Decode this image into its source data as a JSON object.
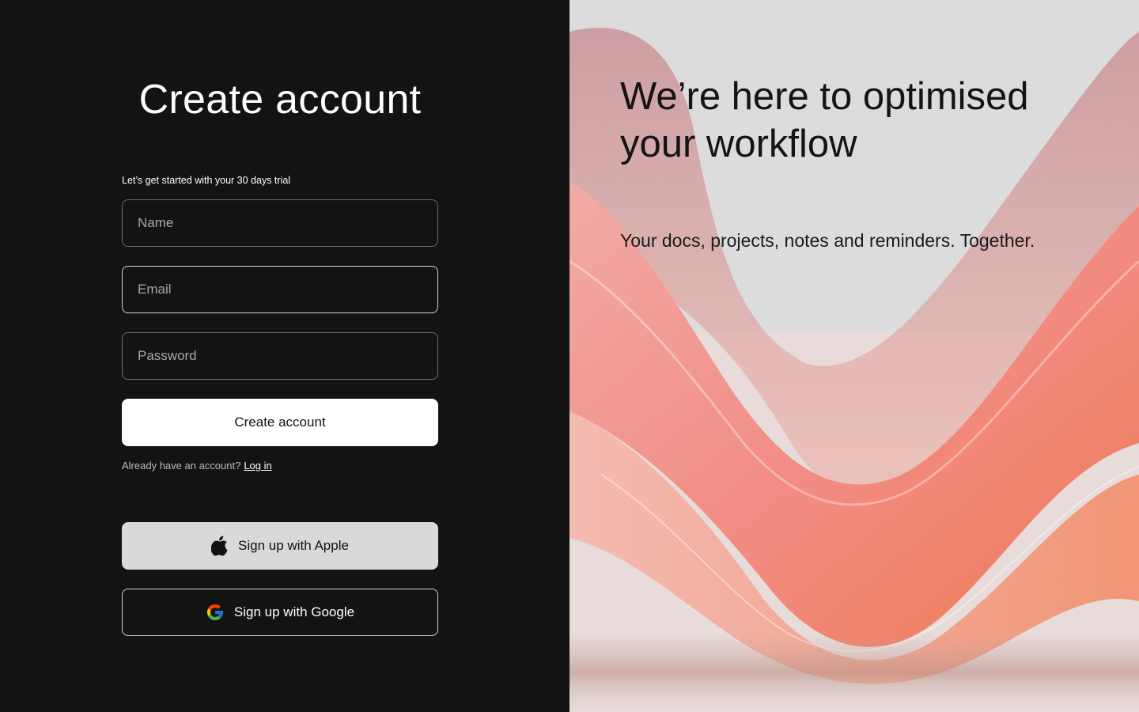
{
  "signup": {
    "title": "Create account",
    "subtitle": "Let’s get started with your 30 days trial",
    "name_placeholder": "Name",
    "email_placeholder": "Email",
    "password_placeholder": "Password",
    "submit_label": "Create account",
    "login_prompt": "Already have an account?",
    "login_link": "Log in",
    "apple_label": "Sign up with Apple",
    "google_label": "Sign up with Google"
  },
  "hero": {
    "headline": "We’re here to optimised your workflow",
    "tagline": "Your docs, projects, notes and reminders. Together."
  },
  "icons": {
    "apple": "apple-icon",
    "google": "google-icon"
  },
  "colors": {
    "left_bg": "#131313",
    "primary_button": "#ffffff",
    "apple_button": "#d9d9d9",
    "accent_pink": "#f08d86",
    "accent_orange": "#f07c4e"
  }
}
